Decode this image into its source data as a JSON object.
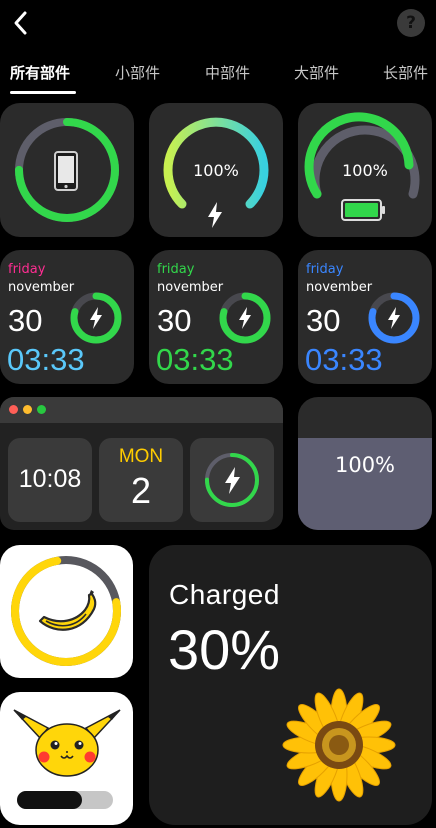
{
  "header": {
    "back_icon": "chevron-left-icon",
    "help_icon": "question-mark-icon",
    "help_glyph": "?"
  },
  "tabs": [
    {
      "label": "所有部件",
      "active": true
    },
    {
      "label": "小部件",
      "active": false
    },
    {
      "label": "中部件",
      "active": false
    },
    {
      "label": "大部件",
      "active": false
    },
    {
      "label": "长部件",
      "active": false
    }
  ],
  "widgets": {
    "phone_ring": {
      "icon": "phone-icon",
      "ring_color": "#32d74b",
      "level": 0.75
    },
    "gradient_gauge": {
      "percent_label": "100%",
      "icon": "lightning-icon",
      "gradient": [
        "#c8f050",
        "#38d0e0"
      ]
    },
    "green_gauge": {
      "percent_label": "100%",
      "icon": "battery-icon",
      "color": "#32d74b"
    },
    "date_cards": [
      {
        "day": "friday",
        "month": "november",
        "date": "30",
        "time": "03:33",
        "day_color": "#ff2d92",
        "time_color": "#5ac8fa",
        "ring_color": "#32d74b"
      },
      {
        "day": "friday",
        "month": "november",
        "date": "30",
        "time": "03:33",
        "day_color": "#32d74b",
        "time_color": "#32d74b",
        "ring_color": "#32d74b"
      },
      {
        "day": "friday",
        "month": "november",
        "date": "30",
        "time": "03:33",
        "day_color": "#3a86ff",
        "time_color": "#3a86ff",
        "ring_color": "#3a86ff"
      }
    ],
    "window_widget": {
      "traffic_lights": [
        "#ff5f57",
        "#febc2e",
        "#28c840"
      ],
      "clock": "10:08",
      "weekday": "MON",
      "weekday_color": "#ffcc00",
      "day": "2"
    },
    "fill_widget": {
      "percent_label": "100%",
      "fill_color": "#5e5e72"
    },
    "banana_widget": {
      "icon": "banana-icon",
      "ring_color": "#ffd60a"
    },
    "pikachu_widget": {
      "icon": "pikachu-icon",
      "level": 0.68
    },
    "charged_widget": {
      "title": "Charged",
      "percent_label": "30%",
      "icon": "sunflower-icon"
    }
  }
}
